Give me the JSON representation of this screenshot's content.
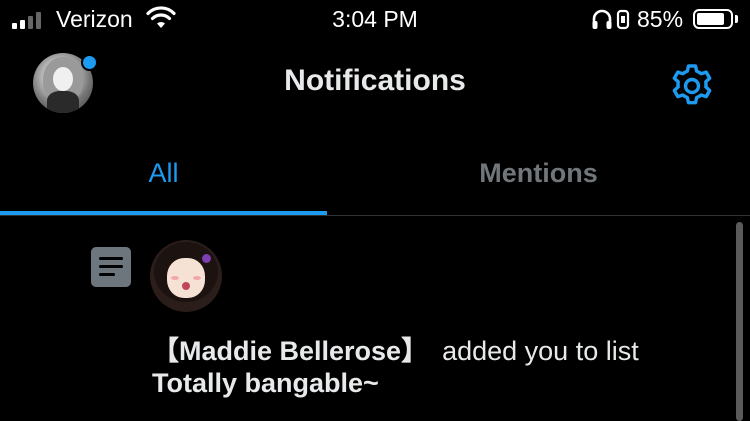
{
  "status_bar": {
    "carrier": "Verizon",
    "time": "3:04 PM",
    "battery_percent_label": "85%",
    "battery_level": 0.85,
    "signal_bars": 2,
    "icons": [
      "signal-icon",
      "wifi-icon",
      "headphones-icon",
      "orientation-lock-icon",
      "battery-icon"
    ]
  },
  "header": {
    "title": "Notifications",
    "icons": [
      "avatar",
      "settings-gear-icon"
    ],
    "accent_color": "#1d9bf0"
  },
  "tabs": [
    {
      "label": "All",
      "selected": true
    },
    {
      "label": "Mentions",
      "selected": false
    }
  ],
  "notifications": [
    {
      "icon": "list-icon",
      "name": "【Maddie Bellerose】",
      "action": "added you to list",
      "list_name": "Totally bangable~"
    }
  ]
}
